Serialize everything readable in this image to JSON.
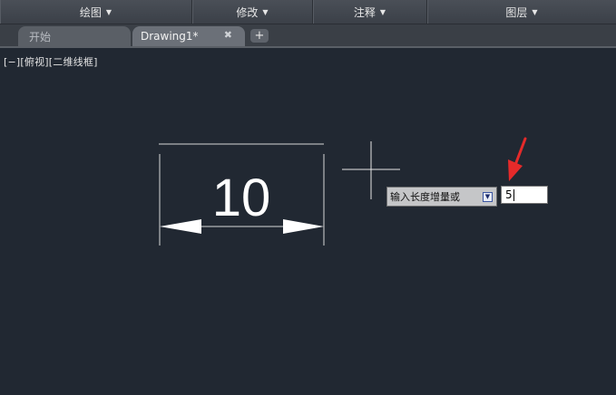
{
  "ribbon": {
    "panels": [
      {
        "label": "绘图"
      },
      {
        "label": "修改"
      },
      {
        "label": "注释"
      },
      {
        "label": "图层"
      }
    ]
  },
  "tabs": {
    "start": "开始",
    "drawing": "Drawing1*",
    "close_glyph": "✖",
    "new_glyph": "+"
  },
  "viewport": {
    "label": "[−][俯视][二维线框]"
  },
  "drawing": {
    "dimension_value": "10"
  },
  "dynamic_input": {
    "prompt": "输入长度增量或",
    "value": "5",
    "arrow_color": "#e52a2a"
  }
}
